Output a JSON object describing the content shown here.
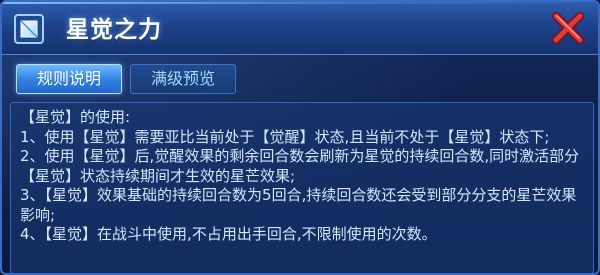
{
  "window": {
    "title": "星觉之力",
    "close_label": "close"
  },
  "tabs": [
    {
      "label": "规则说明",
      "active": true
    },
    {
      "label": "满级预览",
      "active": false
    }
  ],
  "content": {
    "paragraphs": [
      "【星觉】的使用:",
      "1、使用【星觉】需要亚比当前处于【觉醒】状态,且当前不处于【星觉】状态下;",
      "2、使用【星觉】后,觉醒效果的剩余回合数会刷新为星觉的持续回合数,同时激活部分【星觉】状态持续期间才生效的星芒效果;",
      "3、【星觉】效果基础的持续回合数为5回合,持续回合数还会受到部分分支的星芒效果影响;",
      "4、【星觉】在战斗中使用,不占用出手回合,不限制使用的次数。"
    ]
  },
  "colors": {
    "title_bar": "#2d5cae",
    "panel_bg": "#0e214b",
    "tab_active": "#2f7fe2",
    "tab_inactive": "#173a73",
    "text": "#d4e6ff",
    "close_icon": "#e23a3a"
  },
  "icons": {
    "emblem": "crystal-emblem-icon",
    "close": "close-x-icon"
  }
}
